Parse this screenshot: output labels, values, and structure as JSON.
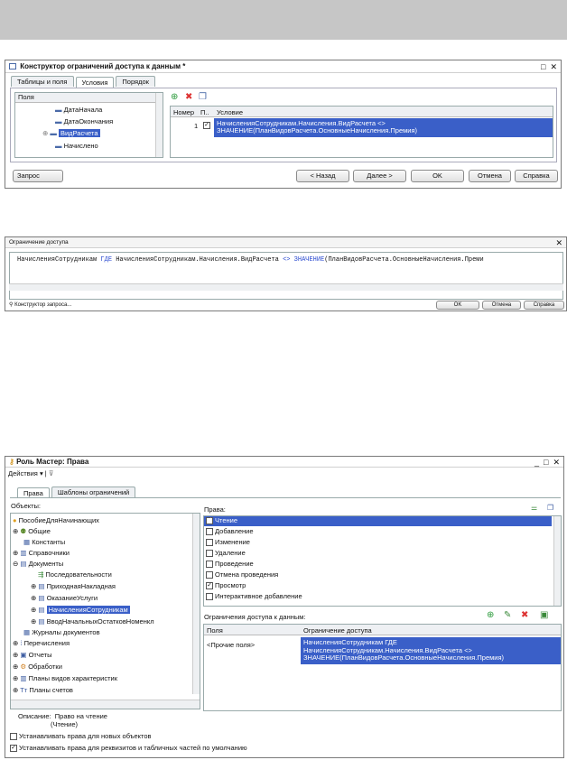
{
  "win1": {
    "title": "Конструктор ограничений доступа к данным *",
    "tabs": [
      "Таблицы и поля",
      "Условия",
      "Порядок"
    ],
    "fields_header": "Поля",
    "fields": [
      "ДатаНачала",
      "ДатаОкончания",
      "ВидРасчета",
      "Начислено"
    ],
    "cond_headers": [
      "Номер",
      "П..",
      "Условие"
    ],
    "cond_row": {
      "num": "1",
      "line1": "НачисленияСотрудникам.Начисления.ВидРасчета <>",
      "line2": "ЗНАЧЕНИЕ(ПланВидовРасчета.ОсновныеНачисления.Премия)"
    },
    "buttons": {
      "query": "Запрос",
      "back": "< Назад",
      "next": "Далее >",
      "ok": "OK",
      "cancel": "Отмена",
      "help": "Справка"
    }
  },
  "win2": {
    "title": "Ограничение доступа",
    "t1": "НачисленияСотрудникам ",
    "t2": "ГДЕ",
    "t3": " НачисленияСотрудникам.Начисления.ВидРасчета ",
    "t4": "<>",
    "t5": " ",
    "t6": "ЗНАЧЕНИЕ",
    "t7": "(ПланВидовРасчета.ОсновныеНачисления.Преми",
    "query_link": "Конструктор запроса...",
    "buttons": {
      "ok": "OK",
      "cancel": "Отмена",
      "help": "Справка"
    }
  },
  "win3": {
    "title": "Роль Мастер: Права",
    "actions": "Действия",
    "tabs": [
      "Права",
      "Шаблоны ограничений"
    ],
    "objects_label": "Объекты:",
    "rights_label": "Права:",
    "tree": [
      "ПособиеДляНачинающих",
      "Общие",
      "Константы",
      "Справочники",
      "Документы",
      "Последовательности",
      "ПриходнаяНакладная",
      "ОказаниеУслуги",
      "НачисленияСотрудникам",
      "ВводНачальныхОстатковНоменкл",
      "Журналы документов",
      "Перечисления",
      "Отчеты",
      "Обработки",
      "Планы видов характеристик",
      "Планы счетов"
    ],
    "rights": [
      {
        "label": "Чтение",
        "checked": true
      },
      {
        "label": "Добавление",
        "checked": false
      },
      {
        "label": "Изменение",
        "checked": false
      },
      {
        "label": "Удаление",
        "checked": false
      },
      {
        "label": "Проведение",
        "checked": false
      },
      {
        "label": "Отмена проведения",
        "checked": false
      },
      {
        "label": "Просмотр",
        "checked": true
      },
      {
        "label": "Интерактивное добавление",
        "checked": false
      }
    ],
    "restrict_label": "Ограничения доступа к данным:",
    "restrict_headers": [
      "Поля",
      "Ограничение доступа"
    ],
    "restrict_row": {
      "field": "<Прочие поля>",
      "line1": "НачисленияСотрудникам ГДЕ",
      "line2": "НачисленияСотрудникам.Начисления.ВидРасчета <>",
      "line3": "ЗНАЧЕНИЕ(ПланВидовРасчета.ОсновныеНачисления.Премия)"
    },
    "desc_label": "Описание:",
    "desc1": "Право на чтение",
    "desc2": "(Чтение)",
    "opt1": "Устанавливать права для новых объектов",
    "opt2": "Устанавливать права для реквизитов и табличных частей по умолчанию"
  }
}
